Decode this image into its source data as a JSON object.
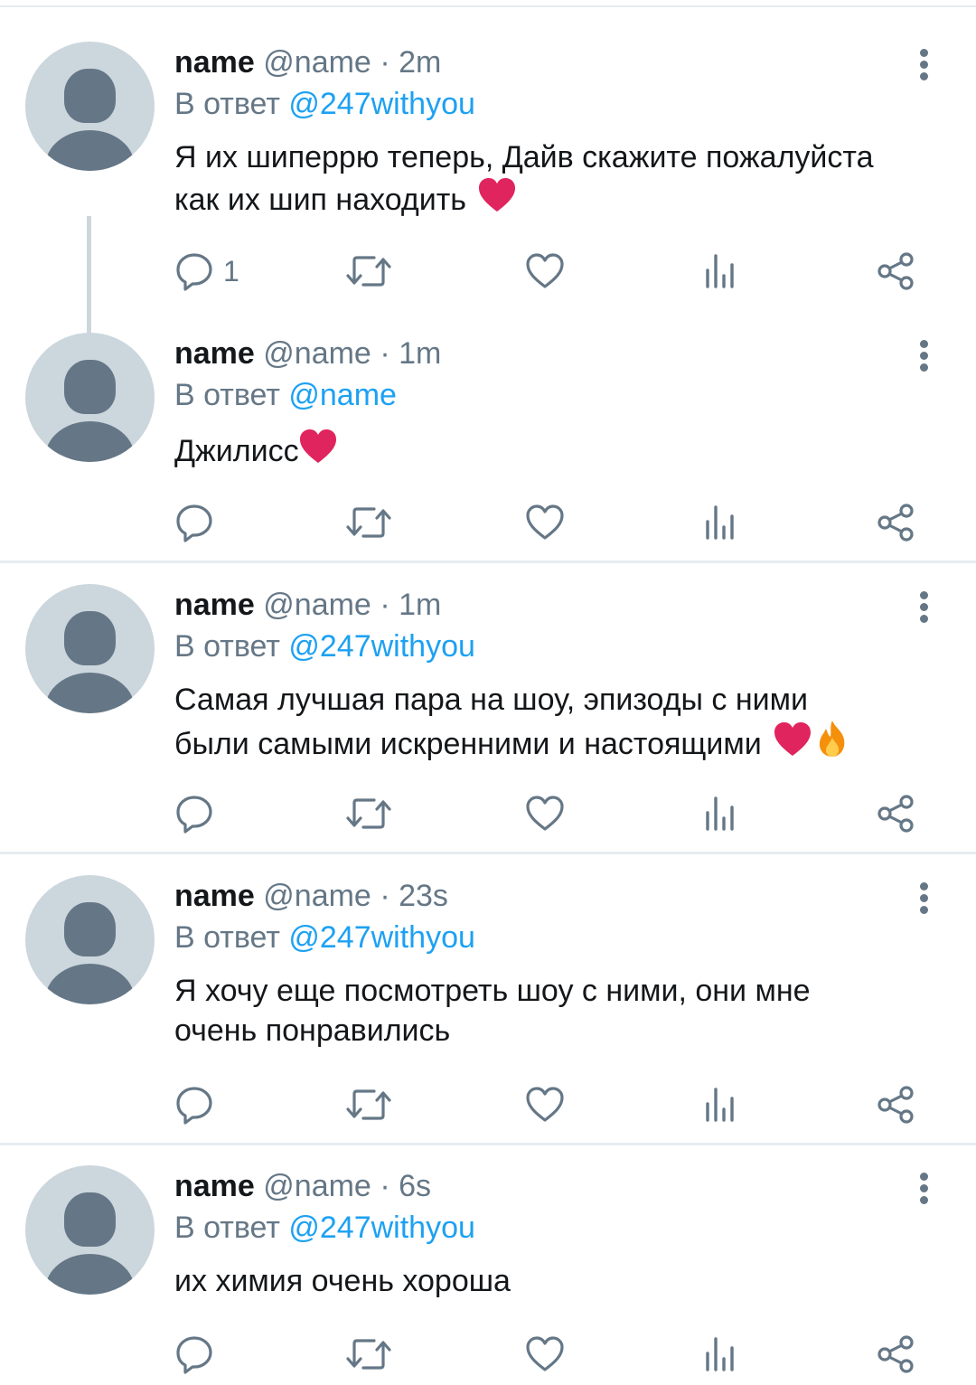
{
  "tweets": [
    {
      "display_name": "name",
      "handle": "@name",
      "time": "2m",
      "reply_prefix": "В ответ",
      "reply_to": "@247withyou",
      "text_lines": [
        "Я их шиперрю теперь, Дайв скажите пожалуйста",
        "как их шип находить"
      ],
      "emojis": [
        "heart"
      ],
      "reply_count": "1"
    },
    {
      "display_name": "name",
      "handle": "@name",
      "time": "1m",
      "reply_prefix": "В ответ",
      "reply_to": "@name",
      "text_lines": [
        "Джилисс"
      ],
      "emojis": [
        "heart"
      ],
      "reply_count": ""
    },
    {
      "display_name": "name",
      "handle": "@name",
      "time": "1m",
      "reply_prefix": "В ответ",
      "reply_to": "@247withyou",
      "text_lines": [
        "Самая лучшая пара на шоу, эпизоды с ними",
        "были самыми искренними и настоящими"
      ],
      "emojis": [
        "heart",
        "fire"
      ],
      "reply_count": ""
    },
    {
      "display_name": "name",
      "handle": "@name",
      "time": "23s",
      "reply_prefix": "В ответ",
      "reply_to": "@247withyou",
      "text_lines": [
        "Я хочу еще посмотреть шоу с ними, они мне",
        "очень понравились"
      ],
      "emojis": [],
      "reply_count": ""
    },
    {
      "display_name": "name",
      "handle": "@name",
      "time": "6s",
      "reply_prefix": "В ответ",
      "reply_to": "@247withyou",
      "text_lines": [
        "их химия очень хороша"
      ],
      "emojis": [],
      "reply_count": ""
    }
  ],
  "icons": {
    "reply": "reply-icon",
    "retweet": "retweet-icon",
    "like": "heart-icon",
    "analytics": "analytics-icon",
    "share": "share-icon",
    "more": "more-vertical-icon"
  },
  "colors": {
    "text": "#14171a",
    "secondary": "#657786",
    "link": "#1da1f2",
    "avatar_bg": "#ccd6dd",
    "divider": "#e6ecf0",
    "heart_emoji": "#e0245e",
    "fire_emoji": "#f4900c"
  }
}
